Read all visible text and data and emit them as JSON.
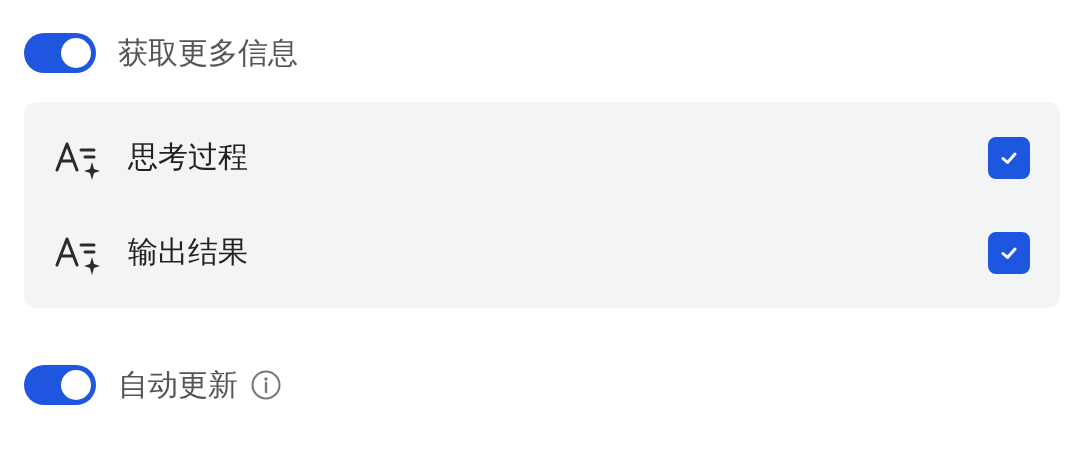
{
  "more_info": {
    "label": "获取更多信息",
    "on": true
  },
  "options": [
    {
      "label": "思考过程",
      "checked": true
    },
    {
      "label": "输出结果",
      "checked": true
    }
  ],
  "auto_update": {
    "label": "自动更新",
    "on": true
  }
}
